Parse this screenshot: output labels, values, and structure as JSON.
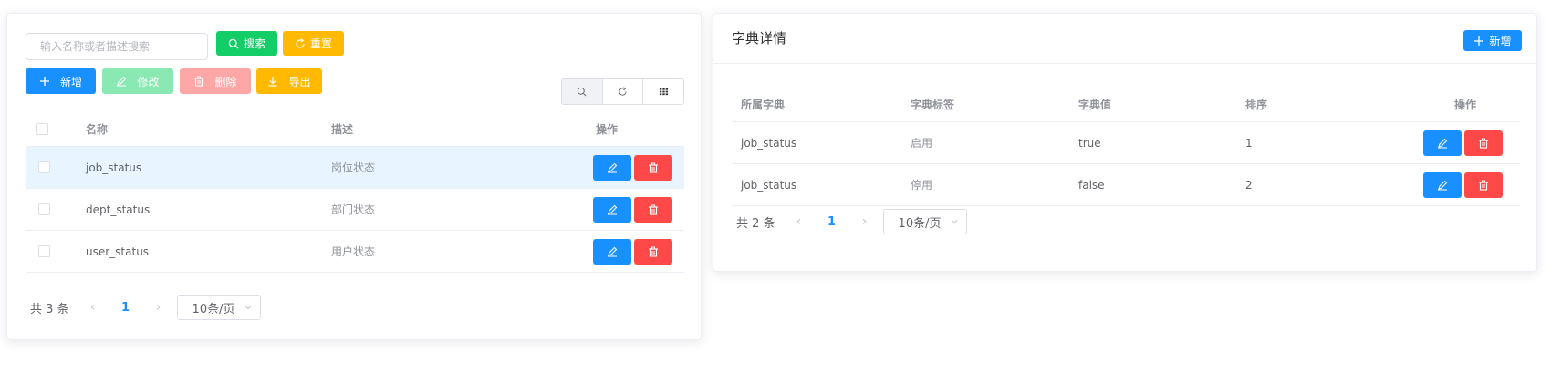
{
  "left": {
    "search": {
      "placeholder": "输入名称或者描述搜索",
      "value": "",
      "search_label": "搜索",
      "reset_label": "重置"
    },
    "toolbar": {
      "add_label": "新增",
      "edit_label": "修改",
      "delete_label": "删除",
      "export_label": "导出"
    },
    "table": {
      "headers": {
        "name": "名称",
        "desc": "描述",
        "op": "操作"
      },
      "rows": [
        {
          "name": "job_status",
          "desc": "岗位状态"
        },
        {
          "name": "dept_status",
          "desc": "部门状态"
        },
        {
          "name": "user_status",
          "desc": "用户状态"
        }
      ]
    },
    "pagination": {
      "total": "共 3 条",
      "current": "1",
      "size": "10条/页"
    }
  },
  "right": {
    "title": "字典详情",
    "add_label": "新增",
    "table": {
      "headers": {
        "dict": "所属字典",
        "label": "字典标签",
        "value": "字典值",
        "sort": "排序",
        "op": "操作"
      },
      "rows": [
        {
          "dict": "job_status",
          "label": "启用",
          "value": "true",
          "sort": "1"
        },
        {
          "dict": "job_status",
          "label": "停用",
          "value": "false",
          "sort": "2"
        }
      ]
    },
    "pagination": {
      "total": "共 2 条",
      "current": "1",
      "size": "10条/页"
    }
  },
  "colors": {
    "primary": "#1890ff",
    "success": "#13ce66",
    "warning": "#ffba00",
    "danger": "#ff4949"
  },
  "icons": [
    "search-icon",
    "refresh-icon",
    "plus-icon",
    "edit-icon",
    "delete-icon",
    "download-icon",
    "grid-icon",
    "chevron-left-icon",
    "chevron-right-icon",
    "chevron-down-icon"
  ]
}
